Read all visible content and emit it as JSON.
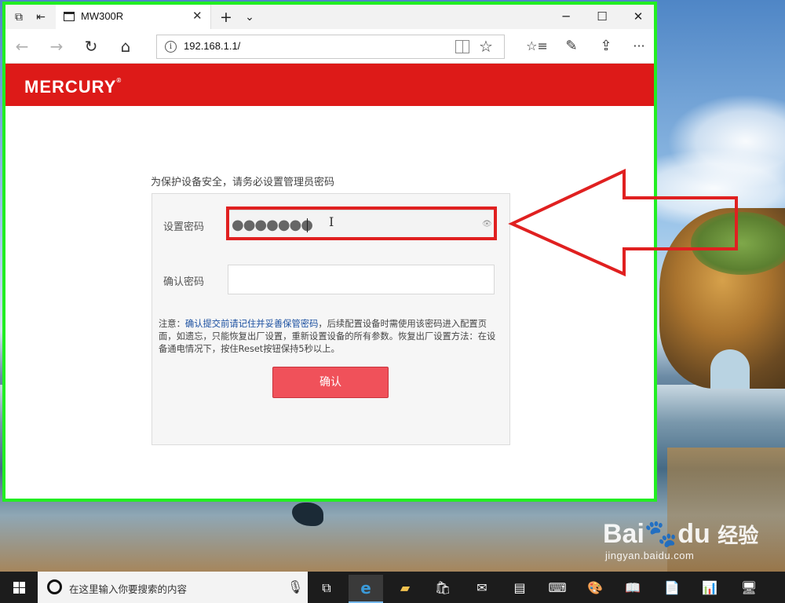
{
  "browser": {
    "tab_title": "MW300R",
    "url": "192.168.1.1/",
    "back_label": "←",
    "forward_label": "→",
    "refresh_label": "↻",
    "home_label": "⌂",
    "tab_close_label": "✕",
    "new_tab_label": "+",
    "tab_list_label": "⌄",
    "minimize_label": "─",
    "maximize_label": "☐",
    "close_label": "✕",
    "favorite_label": "☆",
    "favorites_hub_label": "☆≡",
    "notes_label": "✎",
    "share_label": "⇪",
    "more_label": "···",
    "tab_aside_label": "⧉",
    "restore_tabs_label": "⇤"
  },
  "router_page": {
    "brand": "MERCURY",
    "brand_mark": "®",
    "notice": "为保护设备安全，请务必设置管理员密码",
    "set_password_label": "设置密码",
    "password_value": "●●●●●●●",
    "confirm_password_label": "确认密码",
    "confirm_password_value": "",
    "note_prefix": "注意：",
    "note_highlight": "确认提交前请记住并妥善保管密码",
    "note_rest": "，后续配置设备时需使用该密码进入配置页面，如遗忘，只能恢复出厂设置，重新设置设备的所有参数。恢复出厂设置方法：在设备通电情况下，按住Reset按钮保持5秒以上。",
    "confirm_button": "确认"
  },
  "watermark": {
    "logo_a": "Bai",
    "logo_paw": "🐾",
    "logo_b": "du",
    "logo_cn": "经验",
    "url": "jingyan.baidu.com"
  },
  "taskbar": {
    "search_placeholder": "在这里输入你要搜索的内容",
    "apps": [
      "task-view",
      "edge",
      "file-explorer",
      "store",
      "mail",
      "app-6",
      "app-7",
      "app-8",
      "app-9",
      "app-10",
      "app-11",
      "app-12"
    ]
  },
  "colors": {
    "brand_red": "#dd1a18",
    "button_red": "#f0515a",
    "highlight_red": "#e02020",
    "window_border_green": "#22ee22"
  }
}
